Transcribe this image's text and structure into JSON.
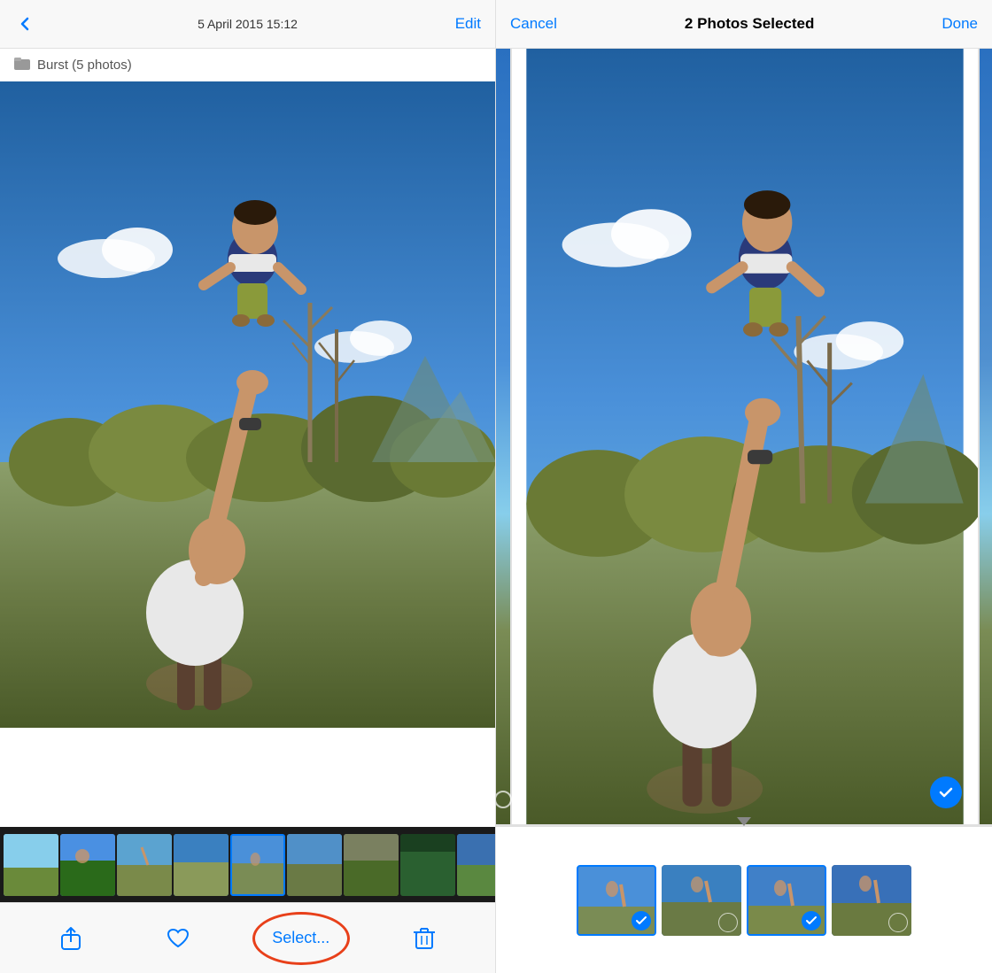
{
  "leftPanel": {
    "header": {
      "dateTime": "5 April 2015  15:12",
      "editLabel": "Edit",
      "backArrow": "‹"
    },
    "burstLabel": "Burst (5 photos)",
    "toolbar": {
      "shareLabel": "share",
      "likeLabel": "like",
      "selectLabel": "Select...",
      "deleteLabel": "delete"
    }
  },
  "rightPanel": {
    "header": {
      "cancelLabel": "Cancel",
      "selectionCount": "2 Photos Selected",
      "doneLabel": "Done"
    }
  },
  "thumbnails": [
    {
      "id": "t1",
      "selected": false
    },
    {
      "id": "t2",
      "selected": false
    },
    {
      "id": "t3",
      "selected": false
    },
    {
      "id": "t4",
      "selected": false
    },
    {
      "id": "t5",
      "selected": true
    },
    {
      "id": "t6",
      "selected": false
    },
    {
      "id": "t7",
      "selected": false
    },
    {
      "id": "t8",
      "selected": false
    },
    {
      "id": "t9",
      "selected": false
    }
  ],
  "burstThumbs": [
    {
      "selected": true
    },
    {
      "selected": false
    },
    {
      "selected": true
    },
    {
      "selected": false
    }
  ],
  "icons": {
    "back": "chevron-left-icon",
    "share": "share-icon",
    "heart": "heart-icon",
    "trash": "trash-icon",
    "check": "checkmark-icon",
    "folder": "folder-icon"
  }
}
